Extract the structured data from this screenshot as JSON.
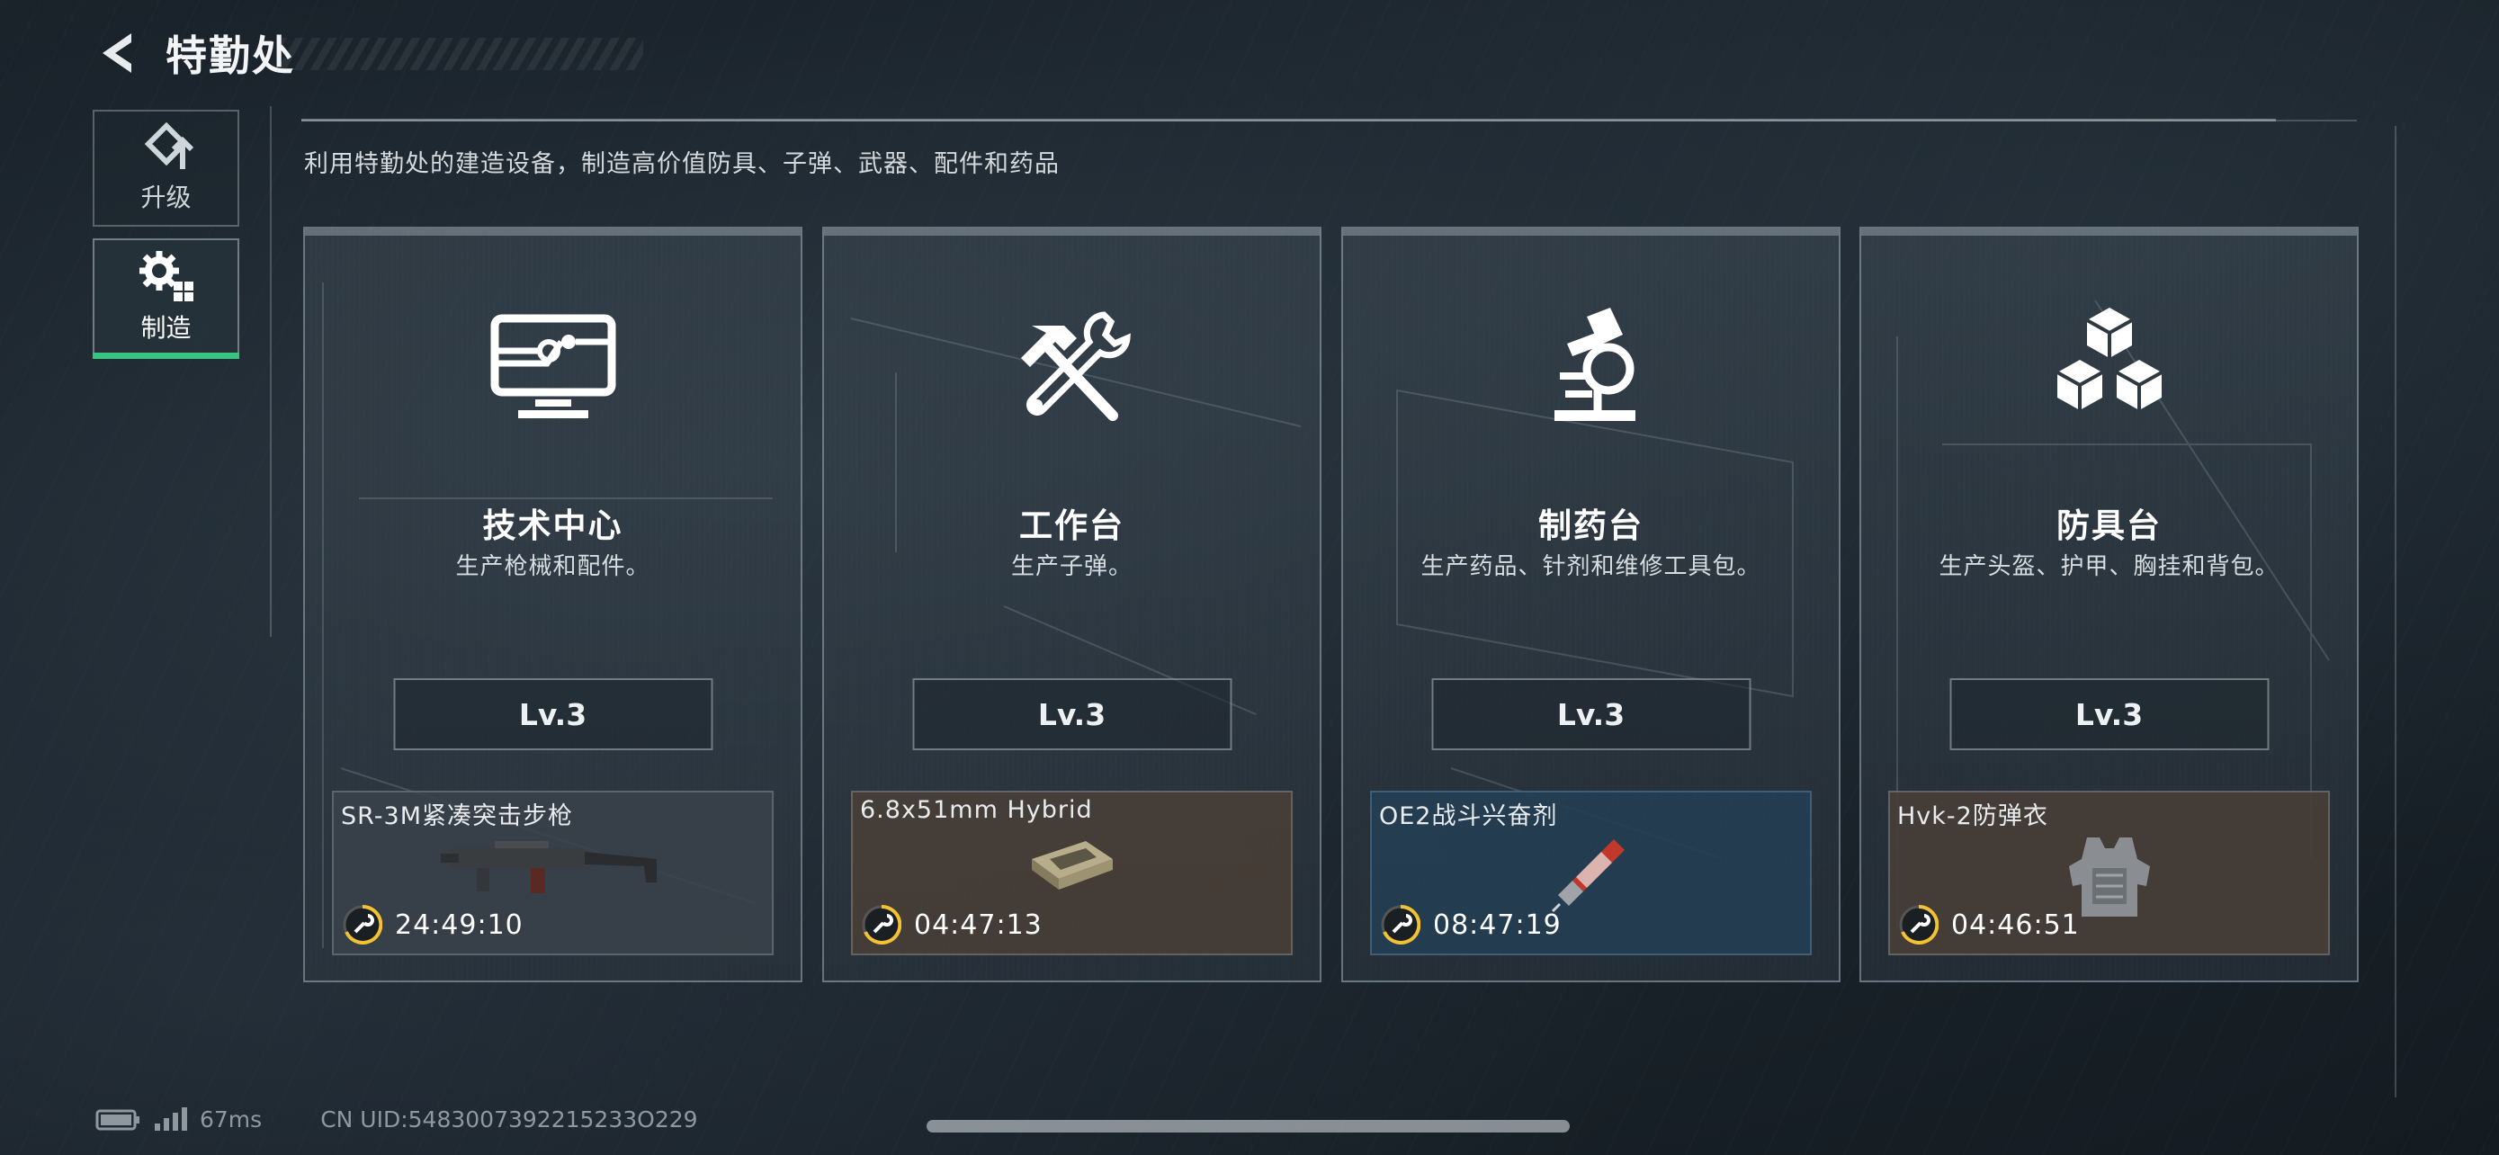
{
  "header": {
    "title": "特勤处"
  },
  "sidebar": {
    "items": [
      {
        "label": "升级",
        "active": false,
        "icon": "upgrade-icon"
      },
      {
        "label": "制造",
        "active": true,
        "icon": "craft-gear-icon"
      }
    ]
  },
  "subtitle": "利用特勤处的建造设备，制造高价值防具、子弹、武器、配件和药品",
  "stations": [
    {
      "name": "技术中心",
      "desc": "生产枪械和配件。",
      "level": "Lv.3",
      "icon": "monitor-circuit-icon",
      "item": {
        "name": "SR-3M紧凑突击步枪",
        "timer": "24:49:10",
        "tone": "gray"
      }
    },
    {
      "name": "工作台",
      "desc": "生产子弹。",
      "level": "Lv.3",
      "icon": "hammer-wrench-icon",
      "item": {
        "name": "6.8x51mm Hybrid",
        "timer": "04:47:13",
        "tone": "brown"
      }
    },
    {
      "name": "制药台",
      "desc": "生产药品、针剂和维修工具包。",
      "level": "Lv.3",
      "icon": "microscope-icon",
      "item": {
        "name": "OE2战斗兴奋剂",
        "timer": "08:47:19",
        "tone": "blue"
      }
    },
    {
      "name": "防具台",
      "desc": "生产头盔、护甲、胸挂和背包。",
      "level": "Lv.3",
      "icon": "cubes-icon",
      "item": {
        "name": "Hvk-2防弹衣",
        "timer": "04:46:51",
        "tone": "brown"
      }
    }
  ],
  "status": {
    "ping": "67ms",
    "uid": "CN UID:5483007392215233O229"
  },
  "colors": {
    "accent_green": "#37c47e",
    "timer_ring": "#f2c233"
  }
}
